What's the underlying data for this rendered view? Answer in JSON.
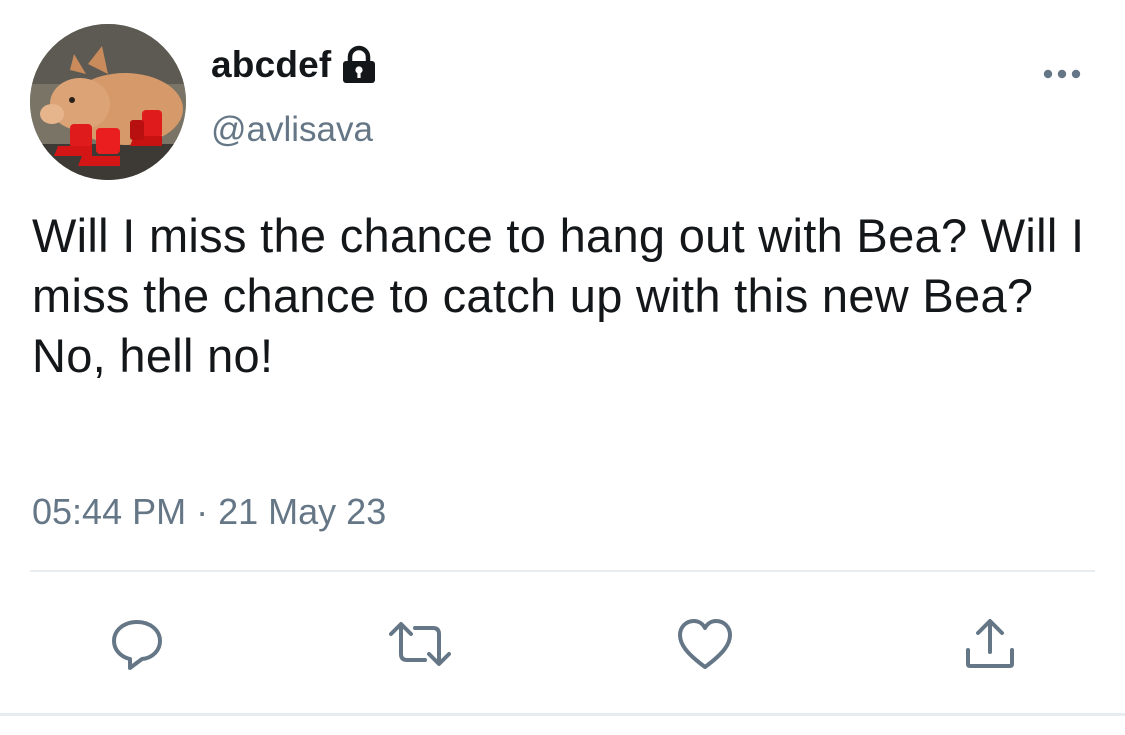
{
  "tweet": {
    "display_name": "abcdef",
    "handle": "@avlisava",
    "text": "Will I miss the chance to hang out with Bea? Will I miss the chance to catch up with this new Bea? No, hell no!",
    "time": "05:44 PM",
    "separator": "·",
    "date": "21 May 23"
  },
  "icons": {
    "lock": "lock-icon",
    "more": "more-icon",
    "reply": "reply-icon",
    "retweet": "retweet-icon",
    "like": "like-icon",
    "share": "share-icon"
  },
  "colors": {
    "text": "#14171a",
    "secondary": "#657786",
    "icon": "#657786",
    "divider": "#e6ecf0"
  }
}
